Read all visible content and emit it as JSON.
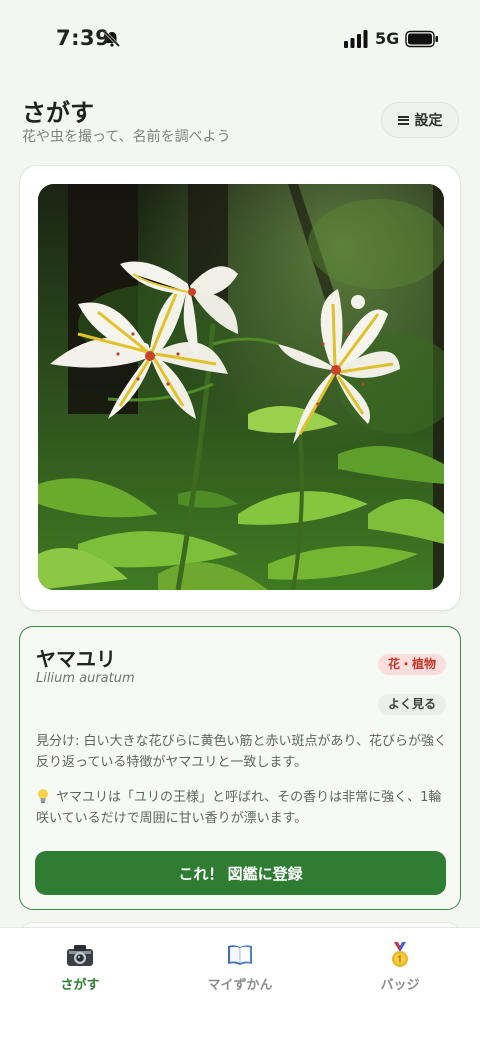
{
  "status_bar": {
    "time": "7:39",
    "network": "5G"
  },
  "header": {
    "title": "さがす",
    "subtitle": "花や虫を撮って、名前を調べよう",
    "settings_label": "設定"
  },
  "result": {
    "name": "ヤマユリ",
    "scientific_name": "Lilium auratum",
    "category": "花・植物",
    "frequency": "よく見る",
    "identification": "見分け: 白い大きな花びらに黄色い筋と赤い斑点があり、花びらが強く反り返っている特徴がヤマユリと一致します。",
    "trivia": "ヤマユリは「ユリの王様」と呼ばれ、その香りは非常に強く、1輪咲いているだけで周囲に甘い香りが漂います。",
    "register_label": "これ！ 図鑑に登録"
  },
  "tabs": [
    {
      "label": "さがす",
      "icon": "camera-icon",
      "active": true
    },
    {
      "label": "マイずかん",
      "icon": "book-icon",
      "active": false
    },
    {
      "label": "バッジ",
      "icon": "medal-icon",
      "active": false
    }
  ],
  "colors": {
    "accent": "#2e7d32",
    "badge_red": "#c0392b",
    "background": "#f3f6f1"
  }
}
